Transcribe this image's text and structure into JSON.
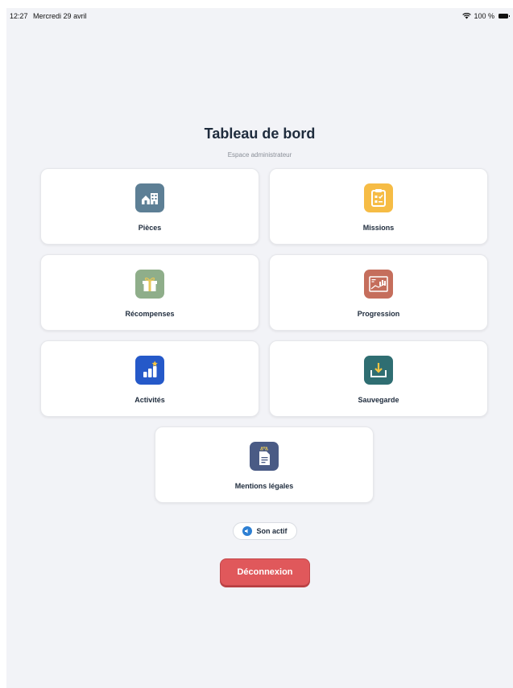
{
  "status_bar": {
    "time": "12:27",
    "date": "Mercredi 29 avril",
    "battery": "100 %"
  },
  "header": {
    "title": "Tableau de bord",
    "subtitle": "Espace administrateur"
  },
  "cards": [
    {
      "label": "Pièces",
      "icon": "house-icon",
      "color": "#5d7f95"
    },
    {
      "label": "Missions",
      "icon": "clipboard-icon",
      "color": "#f6bc45"
    },
    {
      "label": "Récompenses",
      "icon": "gift-icon",
      "color": "#8fae8a"
    },
    {
      "label": "Progression",
      "icon": "chart-frame-icon",
      "color": "#c56e5c"
    },
    {
      "label": "Activités",
      "icon": "bar-star-icon",
      "color": "#2559c9"
    },
    {
      "label": "Sauvegarde",
      "icon": "download-tray-icon",
      "color": "#2f6e72"
    },
    {
      "label": "Mentions légales",
      "icon": "legal-document-icon",
      "color": "#4a5b85"
    }
  ],
  "sound_toggle": {
    "label": "Son actif",
    "icon": "speaker-icon",
    "color": "#2d7fd3"
  },
  "logout": {
    "label": "Déconnexion",
    "color": "#e0585b"
  }
}
